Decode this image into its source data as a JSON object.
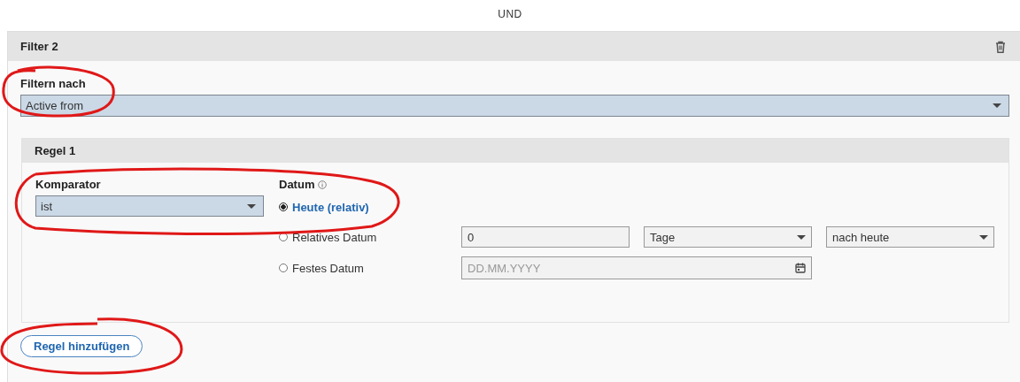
{
  "connector": "UND",
  "filter": {
    "title": "Filter 2",
    "field_label": "Filtern nach",
    "field_value": "Active from",
    "rules": [
      {
        "title": "Regel 1",
        "comparator_label": "Komparator",
        "comparator_value": "ist",
        "date_label": "Datum",
        "date_options": [
          {
            "label": "Heute (relativ)",
            "selected": true,
            "kind": "plain"
          },
          {
            "label": "Relatives Datum",
            "selected": false,
            "kind": "relative",
            "amount": "0",
            "unit": "Tage",
            "direction": "nach heute"
          },
          {
            "label": "Festes Datum",
            "selected": false,
            "kind": "fixed",
            "placeholder": "DD.MM.YYYY"
          }
        ]
      }
    ],
    "add_rule_button": "Regel hinzufügen"
  }
}
